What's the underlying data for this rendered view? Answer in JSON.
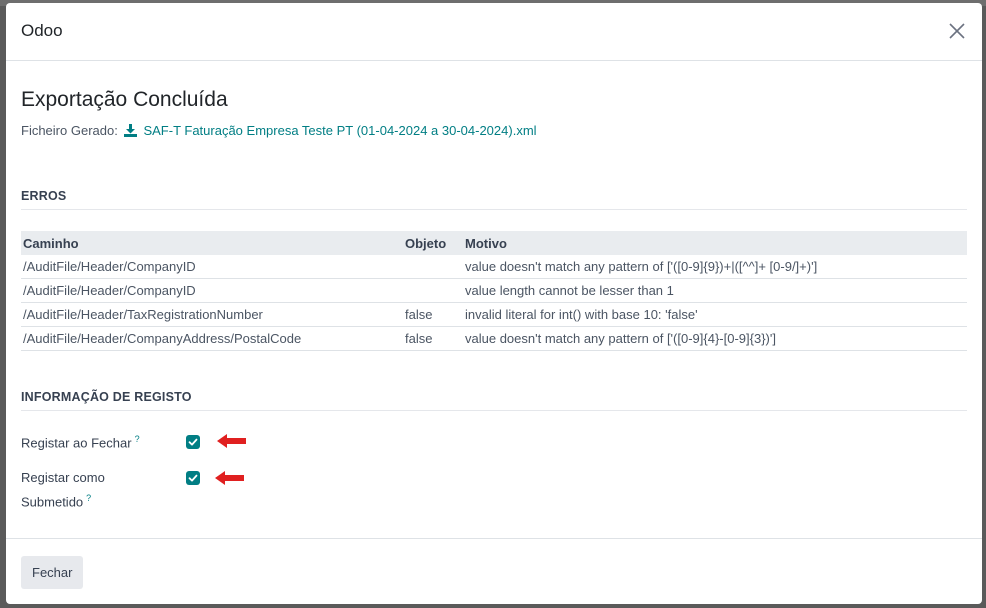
{
  "dialog": {
    "title": "Odoo",
    "close_icon": "close-icon"
  },
  "main": {
    "heading": "Exportação Concluída",
    "file_label": "Ficheiro Gerado:",
    "file_icon": "download-icon",
    "file_name": "SAF-T Faturação Empresa Teste PT (01-04-2024 a 30-04-2024).xml"
  },
  "errors": {
    "section_title": "ERROS",
    "columns": [
      "Caminho",
      "Objeto",
      "Motivo"
    ],
    "rows": [
      [
        "/AuditFile/Header/CompanyID",
        "",
        "value doesn't match any pattern of ['([0-9]{9})+|([^^]+ [0-9/]+)']"
      ],
      [
        "/AuditFile/Header/CompanyID",
        "",
        "value length cannot be lesser than 1"
      ],
      [
        "/AuditFile/Header/TaxRegistrationNumber",
        "false",
        "invalid literal for int() with base 10: 'false'"
      ],
      [
        "/AuditFile/Header/CompanyAddress/PostalCode",
        "false",
        "value doesn't match any pattern of ['([0-9]{4}-[0-9]{3})']"
      ]
    ]
  },
  "registration": {
    "section_title": "INFORMAÇÃO DE REGISTO",
    "fields": [
      {
        "label": "Registar ao Fechar",
        "help": "?",
        "checked": true
      },
      {
        "label": "Registar como Submetido",
        "help": "?",
        "checked": true
      }
    ]
  },
  "footer": {
    "close_label": "Fechar"
  },
  "colors": {
    "accent": "#017e84",
    "annotation_arrow": "#e02020"
  }
}
